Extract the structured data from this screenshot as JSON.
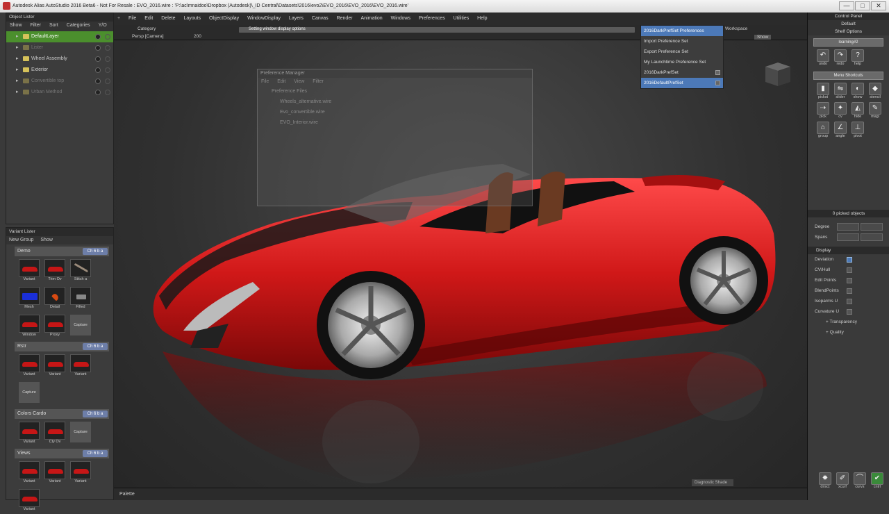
{
  "window": {
    "title": "Autodesk Alias AutoStudio 2016 Beta6 - Not For Resale : EVO_2016.wire : 'P:\\ac\\mnaidoo\\Dropbox (Autodesk)\\_ID Central\\Datasets\\2016\\evo2\\EVO_2016\\EVO_2016\\EVO_2016.wire'",
    "minimize": "—",
    "maximize": "□",
    "close": "✕"
  },
  "menus": [
    "File",
    "Edit",
    "Delete",
    "Layouts",
    "ObjectDisplay",
    "WindowDisplay",
    "Layers",
    "Canvas",
    "Render",
    "Animation",
    "Windows",
    "Preferences",
    "Utilities",
    "Help"
  ],
  "outliner": {
    "title": "Object Lister",
    "tabs": [
      "Show",
      "Filter",
      "Sort",
      "Categories",
      "Y/O"
    ],
    "items": [
      {
        "label": "DefaultLayer",
        "selected": true,
        "dim": false
      },
      {
        "label": "Lister",
        "selected": false,
        "dim": true
      },
      {
        "label": "Wheel Assembly",
        "selected": false,
        "dim": false
      },
      {
        "label": "Exterior",
        "selected": false,
        "dim": false
      },
      {
        "label": "Convertible top",
        "selected": false,
        "dim": true
      },
      {
        "label": "Urban Method",
        "selected": false,
        "dim": true
      }
    ]
  },
  "variants": {
    "title": "Variant Lister",
    "new_group": "New Group",
    "show": "Show",
    "groups": [
      {
        "name": "Demo",
        "cd": "Ch 6 b a",
        "items": [
          "Variant",
          "Trim Ov",
          "Stitch a",
          "Mesh",
          "Detail",
          "Filled",
          "Window",
          "Proxy",
          "Capture"
        ]
      },
      {
        "name": "Rstr",
        "cd": "Ch 6 b a",
        "items": [
          "Variant",
          "Variant",
          "Variant",
          "Capture"
        ]
      },
      {
        "name": "Colors Cardo",
        "cd": "Ch 6 b a",
        "items": [
          "Variant",
          "Cty Ov",
          "Capture"
        ]
      },
      {
        "name": "Views",
        "cd": "Ch 6 b a",
        "items": [
          "Variant",
          "Variant",
          "Variant",
          "Variant"
        ]
      }
    ]
  },
  "viewport": {
    "category_label": "Category",
    "camera_label": "Persp [Camera]",
    "zoom_label": "200",
    "status_message": "Setting window display options",
    "workspace_label": "Workspace",
    "show_label": "Show",
    "diagnostic_shade": "Diagnostic Shade"
  },
  "pref_manager": {
    "title": "Preference Manager",
    "menus": [
      "File",
      "Edit",
      "View",
      "Filter"
    ],
    "root": "Preference Files",
    "files": [
      "Wheels_alternative.wire",
      "Evo_convertible.wire",
      "EVO_Interior.wire"
    ]
  },
  "dropdown": {
    "items": [
      "2016DarkPrefSet Preferences",
      "Import Preference Set",
      "Export Preference Set",
      "My Launchtime Preference Set",
      "2016DarkPrefSet",
      "2016DefaultPrefSet"
    ],
    "highlighted": [
      0,
      5
    ]
  },
  "control_panel": {
    "title": "Control Panel",
    "default_btn": "Default",
    "shelf_options": "Shelf Options",
    "learning": "learning#2",
    "menu_shortcuts": "Menu Shortcuts",
    "shelf1": [
      {
        "label": "undo",
        "icon": "↶"
      },
      {
        "label": "redo",
        "icon": "↷"
      },
      {
        "label": "help",
        "icon": "?"
      }
    ],
    "shelf2": [
      {
        "label": "pickst",
        "icon": "▮"
      },
      {
        "label": "slider",
        "icon": "⇋"
      },
      {
        "label": "show",
        "icon": "◐"
      },
      {
        "label": "stencil",
        "icon": "◆"
      },
      {
        "label": "pick",
        "icon": "⇢"
      },
      {
        "label": "cv",
        "icon": "✦"
      },
      {
        "label": "hide",
        "icon": "◭"
      },
      {
        "label": "magi",
        "icon": "✎"
      },
      {
        "label": "group",
        "icon": "⌂"
      },
      {
        "label": "angle",
        "icon": "∠"
      },
      {
        "label": "pivot",
        "icon": "⊥"
      }
    ],
    "picked": "0 picked objects",
    "degree": "Degree",
    "spans": "Spans",
    "display_header": "Display",
    "rows": [
      {
        "label": "Deviation",
        "on": true
      },
      {
        "label": "CV/Hull",
        "on": false
      },
      {
        "label": "Edit Points",
        "on": false
      },
      {
        "label": "BlendPoints",
        "on": false
      },
      {
        "label": "Isoparms U",
        "on": false
      },
      {
        "label": "Curvature U",
        "on": false
      }
    ],
    "transparency": "Transparency",
    "quality": "Quality",
    "bottom_shelf": [
      {
        "label": "dirsct",
        "icon": "✸"
      },
      {
        "label": "xcurf",
        "icon": "✐"
      },
      {
        "label": "curvs",
        "icon": "⌒"
      },
      {
        "label": "cntrl",
        "icon": "✔"
      }
    ]
  },
  "palette": {
    "label": "Palette"
  },
  "colors": {
    "car_red": "#d01818",
    "highlight": "#4c79b8",
    "layer_selected": "#4b8f2d"
  }
}
